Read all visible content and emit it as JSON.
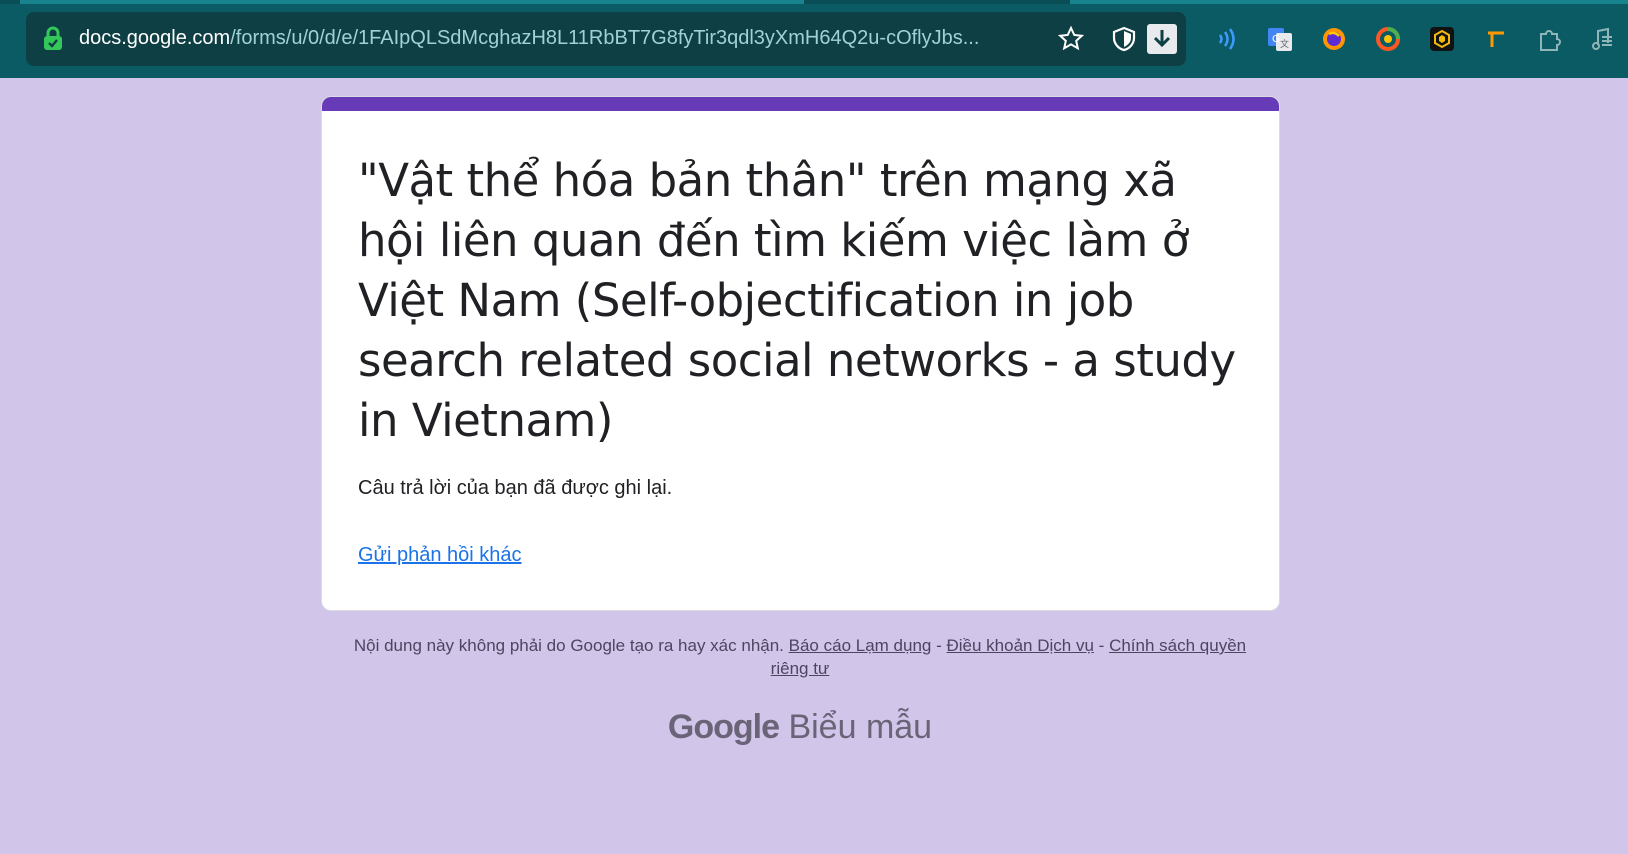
{
  "browser": {
    "url_host": "docs.google.com",
    "url_path": "/forms/u/0/d/e/1FAIpQLSdMcghazH8L11RbBT7G8fyTir3qdl3yXmH64Q2u-cOflyJbs...",
    "icons": [
      "lock-icon",
      "star-icon",
      "shield-icon",
      "download-icon",
      "wave-extension-icon",
      "translate-extension-icon",
      "firefox-extension-icon",
      "chrome-ring-extension-icon",
      "cube-extension-icon",
      "tag-extension-icon",
      "puzzle-extension-icon",
      "music-extension-icon"
    ]
  },
  "form": {
    "title": "\"Vật thể hóa bản thân\" trên mạng xã hội liên quan đến tìm kiếm việc làm ở Việt Nam (Self-objectification in job search related social networks - a study in Vietnam)",
    "confirmation": "Câu trả lời của bạn đã được ghi lại.",
    "another_response_link": "Gửi phản hồi khác"
  },
  "footer": {
    "disclaimer": "Nội dung này không phải do Google tạo ra hay xác nhận.",
    "report_abuse": "Báo cáo Lạm dụng",
    "separator": "-",
    "terms": "Điều khoản Dịch vụ",
    "privacy": "Chính sách quyền riêng tư",
    "logo_google": "Google",
    "logo_product": "Biểu mẫu"
  },
  "colors": {
    "page_background": "#d1c5e9",
    "accent": "#673ab7",
    "link": "#1a73e8",
    "chrome": "#0b5b64"
  }
}
